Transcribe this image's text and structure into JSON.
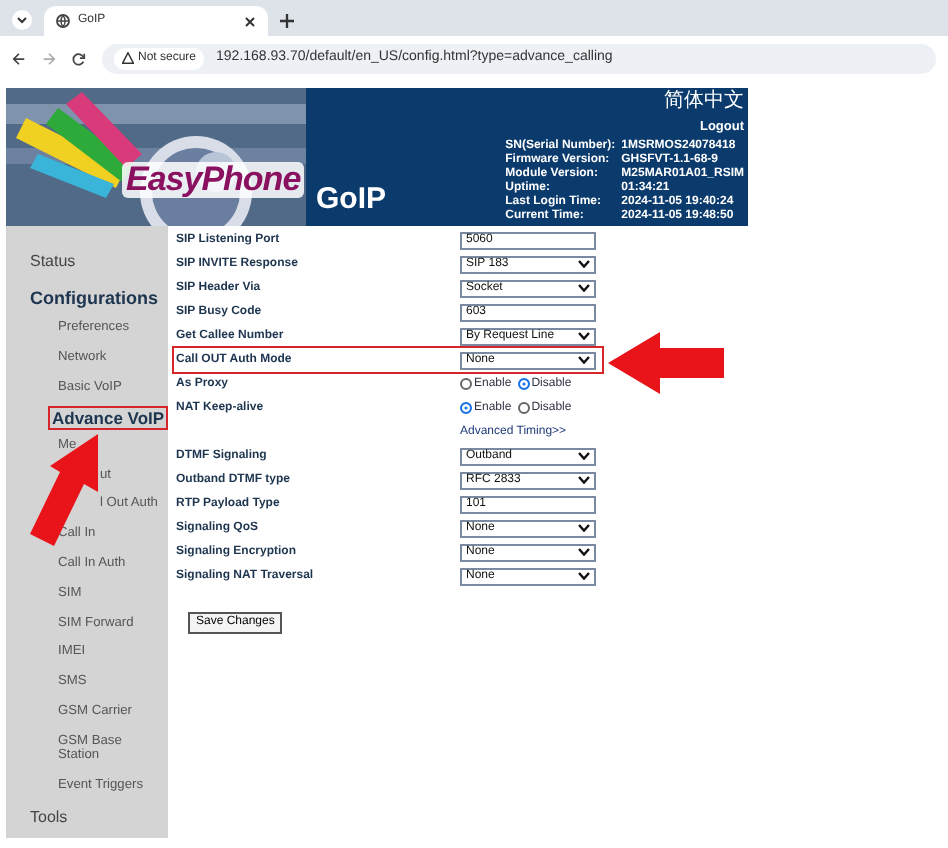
{
  "browser": {
    "tab_title": "GoIP",
    "security_label": "Not secure",
    "url": "192.168.93.70/default/en_US/config.html?type=advance_calling"
  },
  "header": {
    "language": "简体中文",
    "logout": "Logout",
    "logo_text": "EasyPhone",
    "product": "GoIP",
    "info": [
      {
        "label": "SN(Serial Number):",
        "value": "1MSRMOS24078418"
      },
      {
        "label": "Firmware Version:",
        "value": "GHSFVT-1.1-68-9"
      },
      {
        "label": "Module Version:",
        "value": "M25MAR01A01_RSIM"
      },
      {
        "label": "Uptime:",
        "value": "01:34:21"
      },
      {
        "label": "Last Login Time:",
        "value": "2024-11-05 19:40:24"
      },
      {
        "label": "Current Time:",
        "value": "2024-11-05 19:48:50"
      }
    ]
  },
  "sidebar": {
    "items": [
      {
        "kind": "section",
        "label": "Status",
        "selected": false,
        "highlighted": false
      },
      {
        "kind": "section",
        "label": "Configurations",
        "selected": true,
        "highlighted": false,
        "children": [
          {
            "label": "Preferences",
            "selected": false,
            "highlighted": false
          },
          {
            "label": "Network",
            "selected": false,
            "highlighted": false
          },
          {
            "label": "Basic VoIP",
            "selected": false,
            "highlighted": false
          },
          {
            "label": "Advance VoIP",
            "selected": true,
            "highlighted": true
          },
          {
            "label": "Me",
            "selected": false,
            "highlighted": false
          },
          {
            "label": "ut",
            "selected": false,
            "highlighted": false,
            "covered": true
          },
          {
            "label": "l Out Auth",
            "selected": false,
            "highlighted": false,
            "covered": true
          },
          {
            "label": "Call In",
            "selected": false,
            "highlighted": false
          },
          {
            "label": "Call In Auth",
            "selected": false,
            "highlighted": false
          },
          {
            "label": "SIM",
            "selected": false,
            "highlighted": false
          },
          {
            "label": "SIM Forward",
            "selected": false,
            "highlighted": false
          },
          {
            "label": "IMEI",
            "selected": false,
            "highlighted": false
          },
          {
            "label": "SMS",
            "selected": false,
            "highlighted": false
          },
          {
            "label": "GSM Carrier",
            "selected": false,
            "highlighted": false
          },
          {
            "label": "GSM Base Station",
            "selected": false,
            "highlighted": false
          },
          {
            "label": "Event Triggers",
            "selected": false,
            "highlighted": false
          }
        ]
      },
      {
        "kind": "section",
        "label": "Tools",
        "selected": false,
        "highlighted": false
      }
    ]
  },
  "form": {
    "rows": [
      {
        "kind": "text",
        "label": "SIP Listening Port",
        "value": "5060",
        "highlighted": false
      },
      {
        "kind": "select",
        "label": "SIP INVITE Response",
        "value": "SIP 183",
        "highlighted": false
      },
      {
        "kind": "select",
        "label": "SIP Header Via",
        "value": "Socket",
        "highlighted": false
      },
      {
        "kind": "text",
        "label": "SIP Busy Code",
        "value": "603",
        "highlighted": false
      },
      {
        "kind": "select",
        "label": "Get Callee Number",
        "value": "By Request Line",
        "highlighted": false
      },
      {
        "kind": "select",
        "label": "Call OUT Auth Mode",
        "value": "None",
        "highlighted": true
      },
      {
        "kind": "radio",
        "label": "As Proxy",
        "options": [
          {
            "label": "Enable",
            "selected": false
          },
          {
            "label": "Disable",
            "selected": true
          }
        ],
        "highlighted": false
      },
      {
        "kind": "radio",
        "label": "NAT Keep-alive",
        "options": [
          {
            "label": "Enable",
            "selected": true
          },
          {
            "label": "Disable",
            "selected": false
          }
        ],
        "highlighted": false
      },
      {
        "kind": "link",
        "label": "Advanced Timing>>",
        "highlighted": false
      },
      {
        "kind": "select",
        "label": "DTMF Signaling",
        "value": "Outband",
        "highlighted": false
      },
      {
        "kind": "select",
        "label": "Outband DTMF type",
        "value": "RFC 2833",
        "highlighted": false
      },
      {
        "kind": "text",
        "label": "RTP Payload Type",
        "value": "101",
        "highlighted": false
      },
      {
        "kind": "select",
        "label": "Signaling QoS",
        "value": "None",
        "highlighted": false
      },
      {
        "kind": "select",
        "label": "Signaling Encryption",
        "value": "None",
        "highlighted": false
      },
      {
        "kind": "select",
        "label": "Signaling NAT Traversal",
        "value": "None",
        "highlighted": false
      }
    ],
    "save_button": "Save Changes"
  }
}
